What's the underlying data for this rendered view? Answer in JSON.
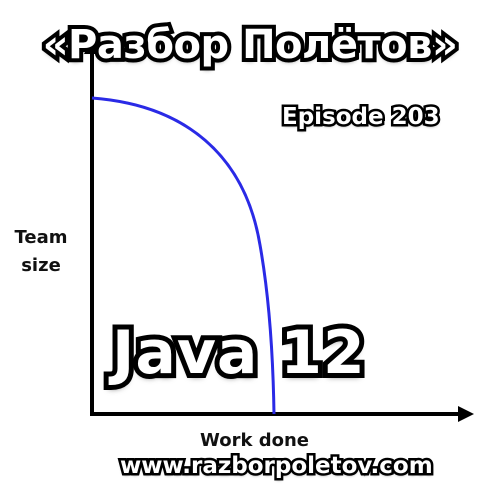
{
  "podcast": {
    "title": "«Разбор Полётов»",
    "episode": "Episode 203"
  },
  "topic": {
    "title": "Java 12"
  },
  "chart": {
    "y_label_line1": "Team",
    "y_label_line2": "size",
    "x_label": "Work done",
    "curve_color": "#2a2ae6",
    "axis_color": "#000000"
  },
  "website": "www.razborpoletov.com"
}
